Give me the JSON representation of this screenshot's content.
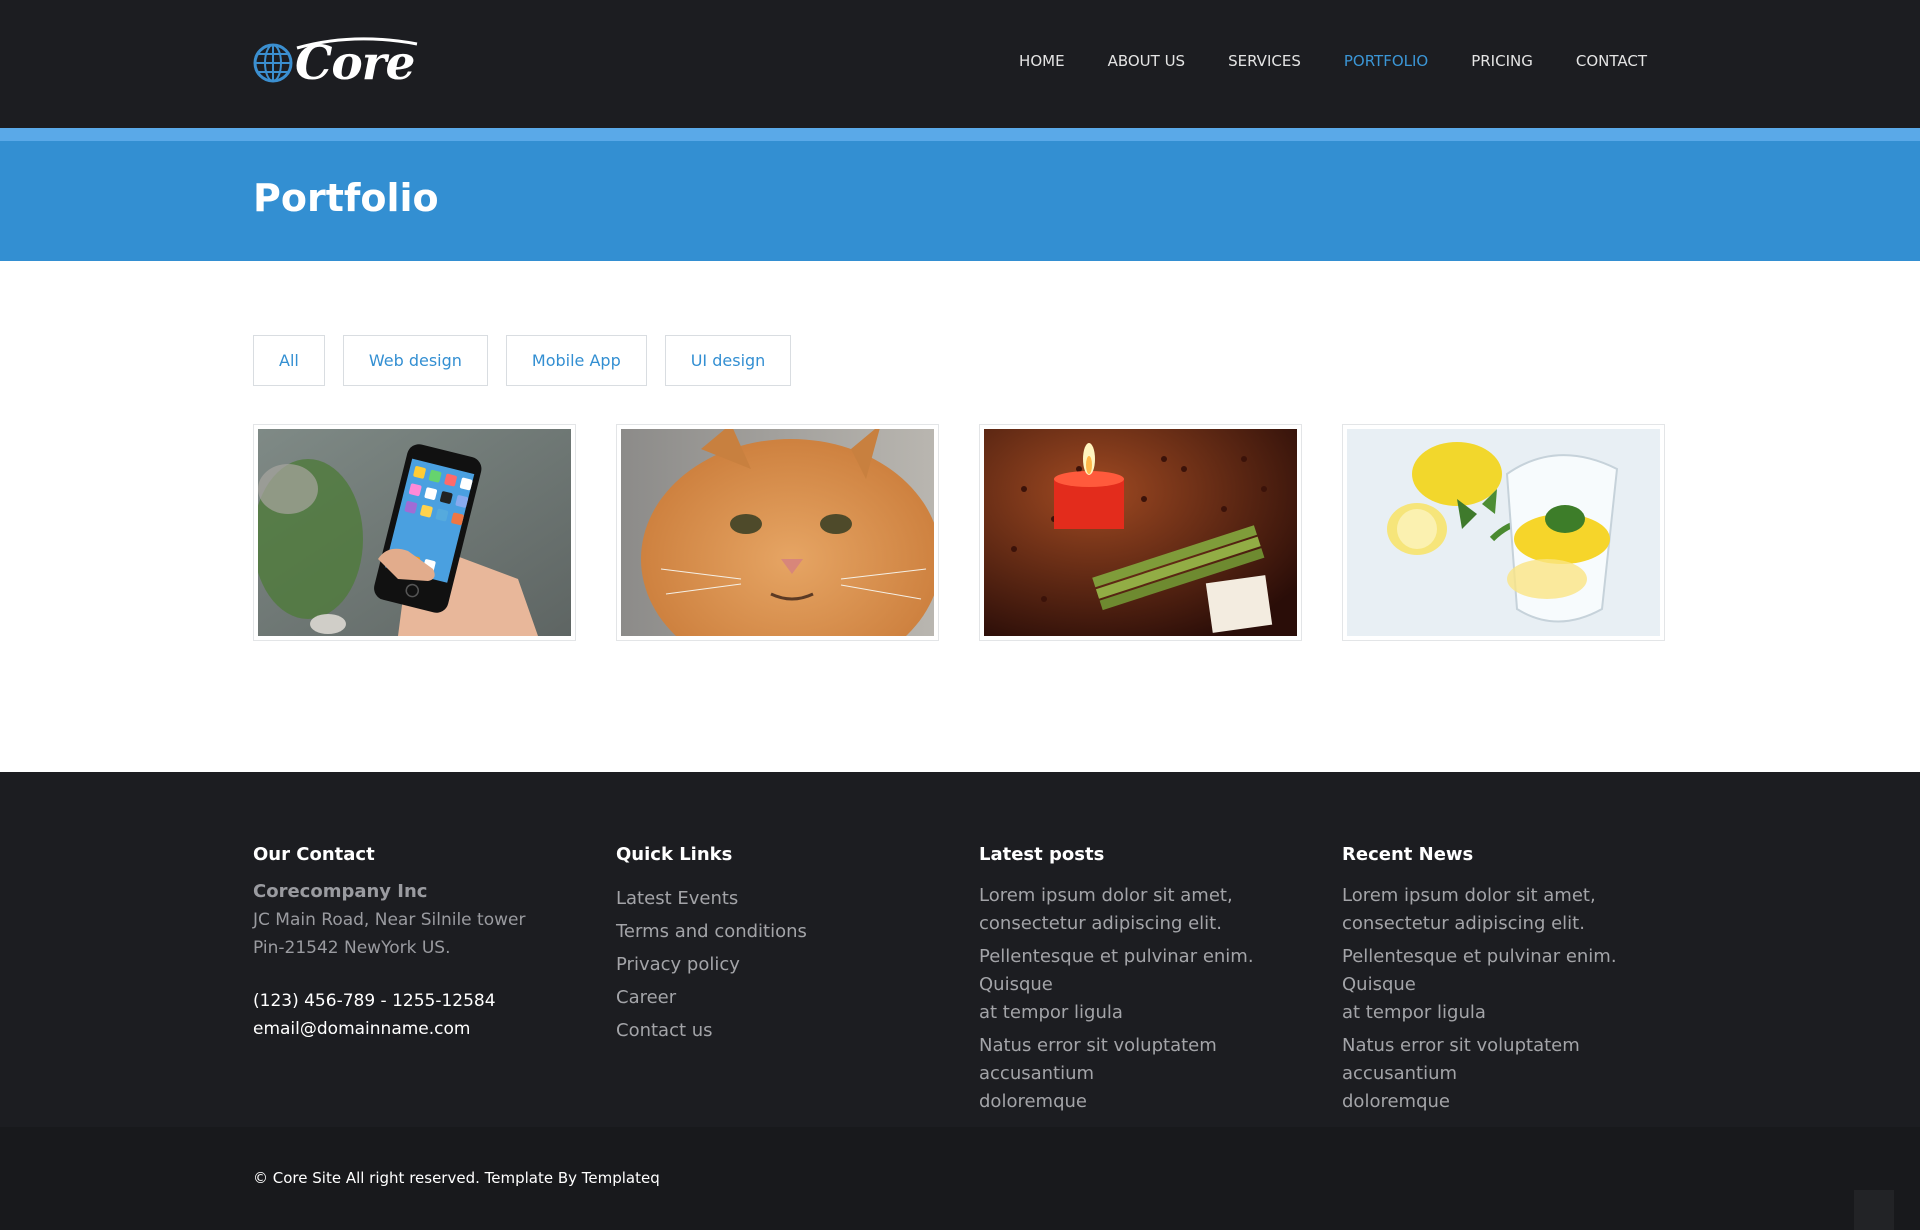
{
  "header": {
    "logo_text": "Core",
    "logo_icon": "globe-icon",
    "nav": [
      {
        "label": "HOME",
        "active": false
      },
      {
        "label": "ABOUT US",
        "active": false
      },
      {
        "label": "SERVICES",
        "active": false
      },
      {
        "label": "PORTFOLIO",
        "active": true
      },
      {
        "label": "PRICING",
        "active": false
      },
      {
        "label": "CONTACT",
        "active": false
      }
    ]
  },
  "banner": {
    "title": "Portfolio"
  },
  "filters": [
    "All",
    "Web design",
    "Mobile App",
    "UI design"
  ],
  "portfolio": [
    {
      "subject": "smartphone in hand"
    },
    {
      "subject": "orange cat"
    },
    {
      "subject": "red candle and incense"
    },
    {
      "subject": "lemons and water glass"
    }
  ],
  "footer": {
    "contact": {
      "heading": "Our Contact",
      "company": "Corecompany Inc",
      "address_line1": "JC Main Road, Near Silnile tower",
      "address_line2": "Pin-21542 NewYork US.",
      "phone": "(123) 456-789 - 1255-12584",
      "email": "email@domainname.com"
    },
    "quick_links": {
      "heading": "Quick Links",
      "items": [
        "Latest Events",
        "Terms and conditions",
        "Privacy policy",
        "Career",
        "Contact us"
      ]
    },
    "latest_posts": {
      "heading": "Latest posts",
      "items": [
        [
          "Lorem ipsum dolor sit amet,",
          "consectetur adipiscing elit."
        ],
        [
          "Pellentesque et pulvinar enim. Quisque",
          "at tempor ligula"
        ],
        [
          "Natus error sit voluptatem accusantium",
          "doloremque"
        ]
      ]
    },
    "recent_news": {
      "heading": "Recent News",
      "items": [
        [
          "Lorem ipsum dolor sit amet,",
          "consectetur adipiscing elit."
        ],
        [
          "Pellentesque et pulvinar enim. Quisque",
          "at tempor ligula"
        ],
        [
          "Natus error sit voluptatem accusantium",
          "doloremque"
        ]
      ]
    },
    "copyright": "© Core Site All right reserved. Template By Templateq"
  },
  "colors": {
    "header_bg": "#1c1d21",
    "accent": "#338fd2",
    "stripe": "#5aa9e8",
    "footer_bg": "#1c1d21",
    "bottom_bg": "#18191c"
  }
}
